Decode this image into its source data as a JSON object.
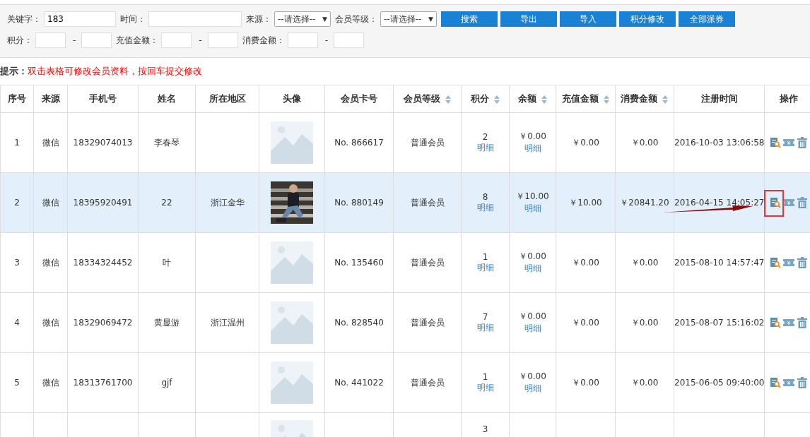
{
  "filters": {
    "row1": [
      {
        "kind": "input",
        "label": "关键字：",
        "value": "183"
      },
      {
        "kind": "input",
        "label": "时间："
      },
      {
        "kind": "select",
        "label": "来源：",
        "value": "--请选择--",
        "caret": "▼"
      },
      {
        "kind": "select",
        "label": "会员等级：",
        "value": "--请选择--",
        "caret": "▼"
      }
    ],
    "buttons": [
      "搜索",
      "导出",
      "导入",
      "积分修改",
      "全部派券"
    ],
    "ranges": [
      {
        "label": "积分：",
        "separator": "-"
      },
      {
        "label": "充值金额：",
        "separator": "-"
      },
      {
        "label": "消费金额：",
        "separator": "-"
      }
    ]
  },
  "hint": {
    "label": "提示：",
    "text": "双击表格可修改会员资料，按回车提交修改"
  },
  "table": {
    "columns": [
      {
        "label": "序号",
        "sortable": false
      },
      {
        "label": "来源",
        "sortable": false
      },
      {
        "label": "手机号",
        "sortable": false
      },
      {
        "label": "姓名",
        "sortable": false
      },
      {
        "label": "所在地区",
        "sortable": false
      },
      {
        "label": "头像",
        "sortable": false
      },
      {
        "label": "会员卡号",
        "sortable": false
      },
      {
        "label": "会员等级",
        "sortable": true
      },
      {
        "label": "积分",
        "sortable": true
      },
      {
        "label": "余额",
        "sortable": true
      },
      {
        "label": "充值金额",
        "sortable": true
      },
      {
        "label": "消费金额",
        "sortable": true
      },
      {
        "label": "注册时间",
        "sortable": false
      },
      {
        "label": "操作",
        "sortable": false
      }
    ],
    "rows": [
      {
        "no": "1",
        "source": "微信",
        "phone": "18329074013",
        "name": "李春琴",
        "avatar": {
          "kind": "placeholder"
        },
        "card": "No. 866617",
        "level": "普通会员",
        "points": "2",
        "points_link": "明细",
        "balance": "￥0.00",
        "balance_link": "明细",
        "recharge": "￥0.00",
        "spent": "￥0.00",
        "registered": "2016-10-03 13:06:58",
        "selected": false,
        "marked": false
      },
      {
        "no": "2",
        "source": "微信",
        "phone": "18395920491",
        "name": "22",
        "region": "浙江金华",
        "card": "No. 880149",
        "level": "普通会员",
        "points": "8",
        "points_link": "明细",
        "balance": "￥10.00",
        "balance_link": "明细",
        "recharge": "￥10.00",
        "spent": "￥20841.20",
        "registered": "2016-04-15 14:05:27",
        "selected": true,
        "marked": true
      },
      {
        "no": "3",
        "source": "微信",
        "phone": "18334324452",
        "name": "叶",
        "avatar": {
          "kind": "placeholder"
        },
        "card": "No. 135460",
        "level": "普通会员",
        "points": "1",
        "points_link": "明细",
        "balance": "￥0.00",
        "balance_link": "明细",
        "recharge": "￥0.00",
        "spent": "￥0.00",
        "registered": "2015-08-10 14:57:47",
        "selected": false,
        "marked": false
      },
      {
        "no": "4",
        "source": "微信",
        "phone": "18329069472",
        "name": "黄显游",
        "region": "浙江温州",
        "avatar": {
          "kind": "placeholder"
        },
        "card": "No. 828540",
        "level": "普通会员",
        "points": "7",
        "points_link": "明细",
        "balance": "￥0.00",
        "balance_link": "明细",
        "recharge": "￥0.00",
        "spent": "￥0.00",
        "registered": "2015-08-07 15:16:02",
        "selected": false,
        "marked": false
      },
      {
        "no": "5",
        "source": "微信",
        "phone": "18313761700",
        "name": "gjf",
        "avatar": {
          "kind": "placeholder"
        },
        "card": "No. 441022",
        "level": "普通会员",
        "points": "1",
        "points_link": "明细",
        "balance": "￥0.00",
        "balance_link": "明细",
        "recharge": "￥0.00",
        "spent": "￥0.00",
        "registered": "2015-06-05 09:40:00",
        "selected": false,
        "marked": false
      },
      {
        "avatar": {
          "kind": "placeholder"
        },
        "points": "3",
        "selected": false
      }
    ]
  }
}
